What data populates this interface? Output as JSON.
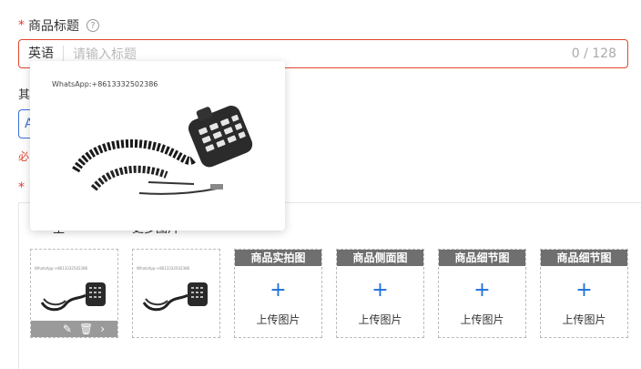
{
  "product_title": {
    "required_mark": "*",
    "label": "商品标题",
    "help_icon": "question-circle-icon",
    "language": "英语",
    "placeholder": "请输入标题",
    "counter": "0 / 128"
  },
  "partial_field": {
    "label": "其",
    "box_text": "A",
    "error_text": "必"
  },
  "images_section": {
    "required_mark": "*",
    "tabs": [
      "主",
      "更多图片"
    ],
    "thumbnails": [
      {
        "caption": "WhatsApp:+8613332502386",
        "has_actions": true
      },
      {
        "caption": "WhatsApp:+8613332502386",
        "has_actions": false
      }
    ],
    "slots": [
      {
        "header": "商品实拍图",
        "plus": "+",
        "label": "上传图片"
      },
      {
        "header": "商品侧面图",
        "plus": "+",
        "label": "上传图片"
      },
      {
        "header": "商品细节图",
        "plus": "+",
        "label": "上传图片"
      },
      {
        "header": "商品细节图",
        "plus": "+",
        "label": "上传图片"
      }
    ]
  },
  "preview_popover": {
    "watermark": "WhatsApp:+8613332502386"
  },
  "colors": {
    "error_red": "#e0462f",
    "accent_blue": "#1e6fd9",
    "slot_header_bg": "#6f6f6f"
  }
}
